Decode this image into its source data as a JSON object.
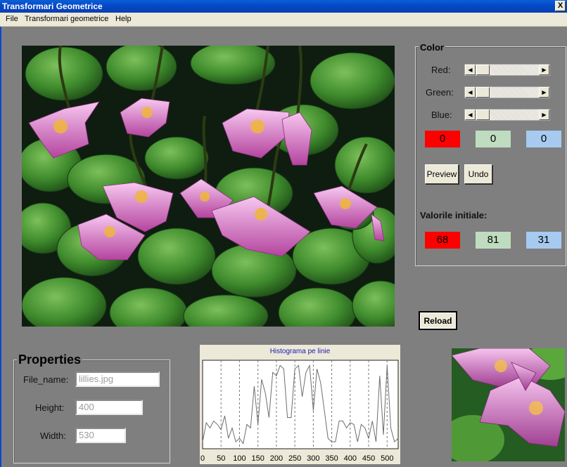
{
  "window": {
    "title": "Transformari Geometrice",
    "close_glyph": "X"
  },
  "menu": {
    "items": [
      "File",
      "Transformari geometrice",
      "Help"
    ]
  },
  "color_panel": {
    "title": "Color",
    "red_label": "Red:",
    "green_label": "Green:",
    "blue_label": "Blue:",
    "red_value": "0",
    "green_value": "0",
    "blue_value": "0",
    "slider_levels": {
      "red": 0,
      "green": 0,
      "blue": 0
    },
    "preview_label": "Preview",
    "undo_label": "Undo",
    "initial_title": "Valorile initiale:",
    "initial_red": "68",
    "initial_green": "81",
    "initial_blue": "31",
    "box_colors": {
      "red": "#ff0000",
      "green": "#c0dcc0",
      "blue": "#a6caf0"
    }
  },
  "reload_label": "Reload",
  "properties": {
    "title": "Properties",
    "file_label": "File_name:",
    "file_value": "lillies.jpg",
    "height_label": "Height:",
    "height_value": "400",
    "width_label": "Width:",
    "width_value": "530"
  },
  "images": {
    "main": "water-lilies-photo",
    "thumbnail": "water-lily-zoomed-photo"
  },
  "chart_data": {
    "type": "line",
    "title": "Histograma pe linie",
    "xlabel": "",
    "ylabel": "",
    "xlim": [
      0,
      530
    ],
    "ylim": [
      0,
      255
    ],
    "grid": "vertical dashed",
    "xticks": [
      0,
      50,
      100,
      150,
      200,
      250,
      300,
      350,
      400,
      450,
      500
    ],
    "x": [
      0,
      10,
      20,
      30,
      40,
      50,
      60,
      70,
      80,
      90,
      100,
      110,
      120,
      130,
      140,
      150,
      160,
      170,
      180,
      190,
      200,
      210,
      220,
      230,
      240,
      250,
      260,
      270,
      280,
      290,
      300,
      310,
      320,
      330,
      340,
      350,
      360,
      370,
      380,
      390,
      400,
      410,
      420,
      430,
      440,
      450,
      460,
      470,
      480,
      490,
      500,
      510,
      520,
      530
    ],
    "series": [
      {
        "values": [
          20,
          75,
          60,
          80,
          70,
          55,
          95,
          30,
          60,
          20,
          30,
          15,
          70,
          60,
          180,
          70,
          200,
          160,
          90,
          220,
          210,
          240,
          230,
          90,
          90,
          230,
          240,
          150,
          220,
          240,
          110,
          230,
          190,
          110,
          30,
          20,
          20,
          80,
          80,
          60,
          75,
          70,
          20,
          70,
          60,
          30,
          80,
          20,
          210,
          40,
          240,
          60,
          20,
          30
        ]
      }
    ]
  }
}
